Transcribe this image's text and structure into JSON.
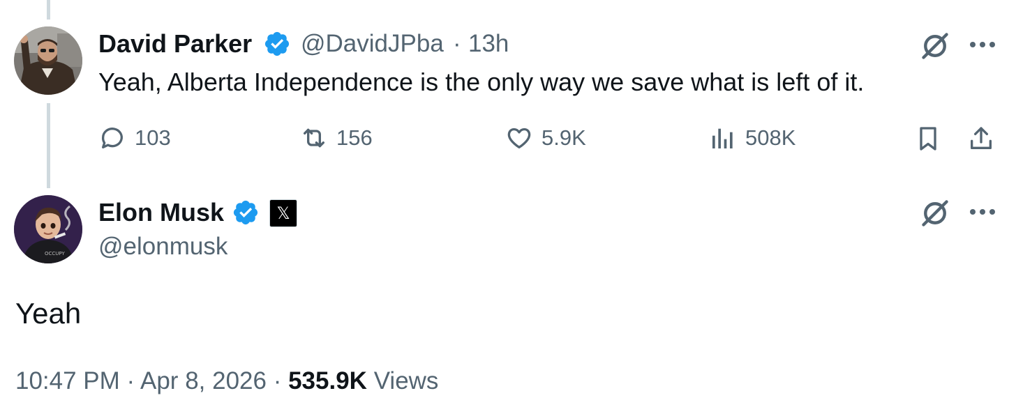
{
  "parent_tweet": {
    "author_name": "David Parker",
    "handle": "@DavidJPba",
    "separator": "·",
    "time": "13h",
    "text": "Yeah, Alberta Independence is the only way we save what is left of it.",
    "actions": {
      "replies": "103",
      "reposts": "156",
      "likes": "5.9K",
      "views": "508K"
    }
  },
  "main_tweet": {
    "author_name": "Elon Musk",
    "affiliation_badge_glyph": "𝕏",
    "handle": "@elonmusk",
    "text": "Yeah",
    "meta": {
      "time": "10:47 PM",
      "sep1": "·",
      "date": "Apr 8, 2026",
      "sep2": "·",
      "views_count": "535.9K",
      "views_label": "Views"
    }
  },
  "colors": {
    "verified": "#1d9bf0",
    "text_primary": "#0f1419",
    "text_secondary": "#536471",
    "thread_line": "#cfd9de"
  }
}
